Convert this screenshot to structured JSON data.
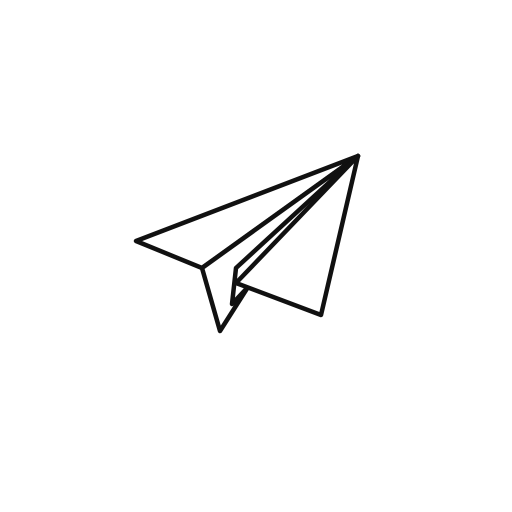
{
  "icon": {
    "name": "paper-plane-icon",
    "stroke_color": "#111111",
    "fill_color": "#ffffff",
    "background_color": "#ffffff"
  }
}
